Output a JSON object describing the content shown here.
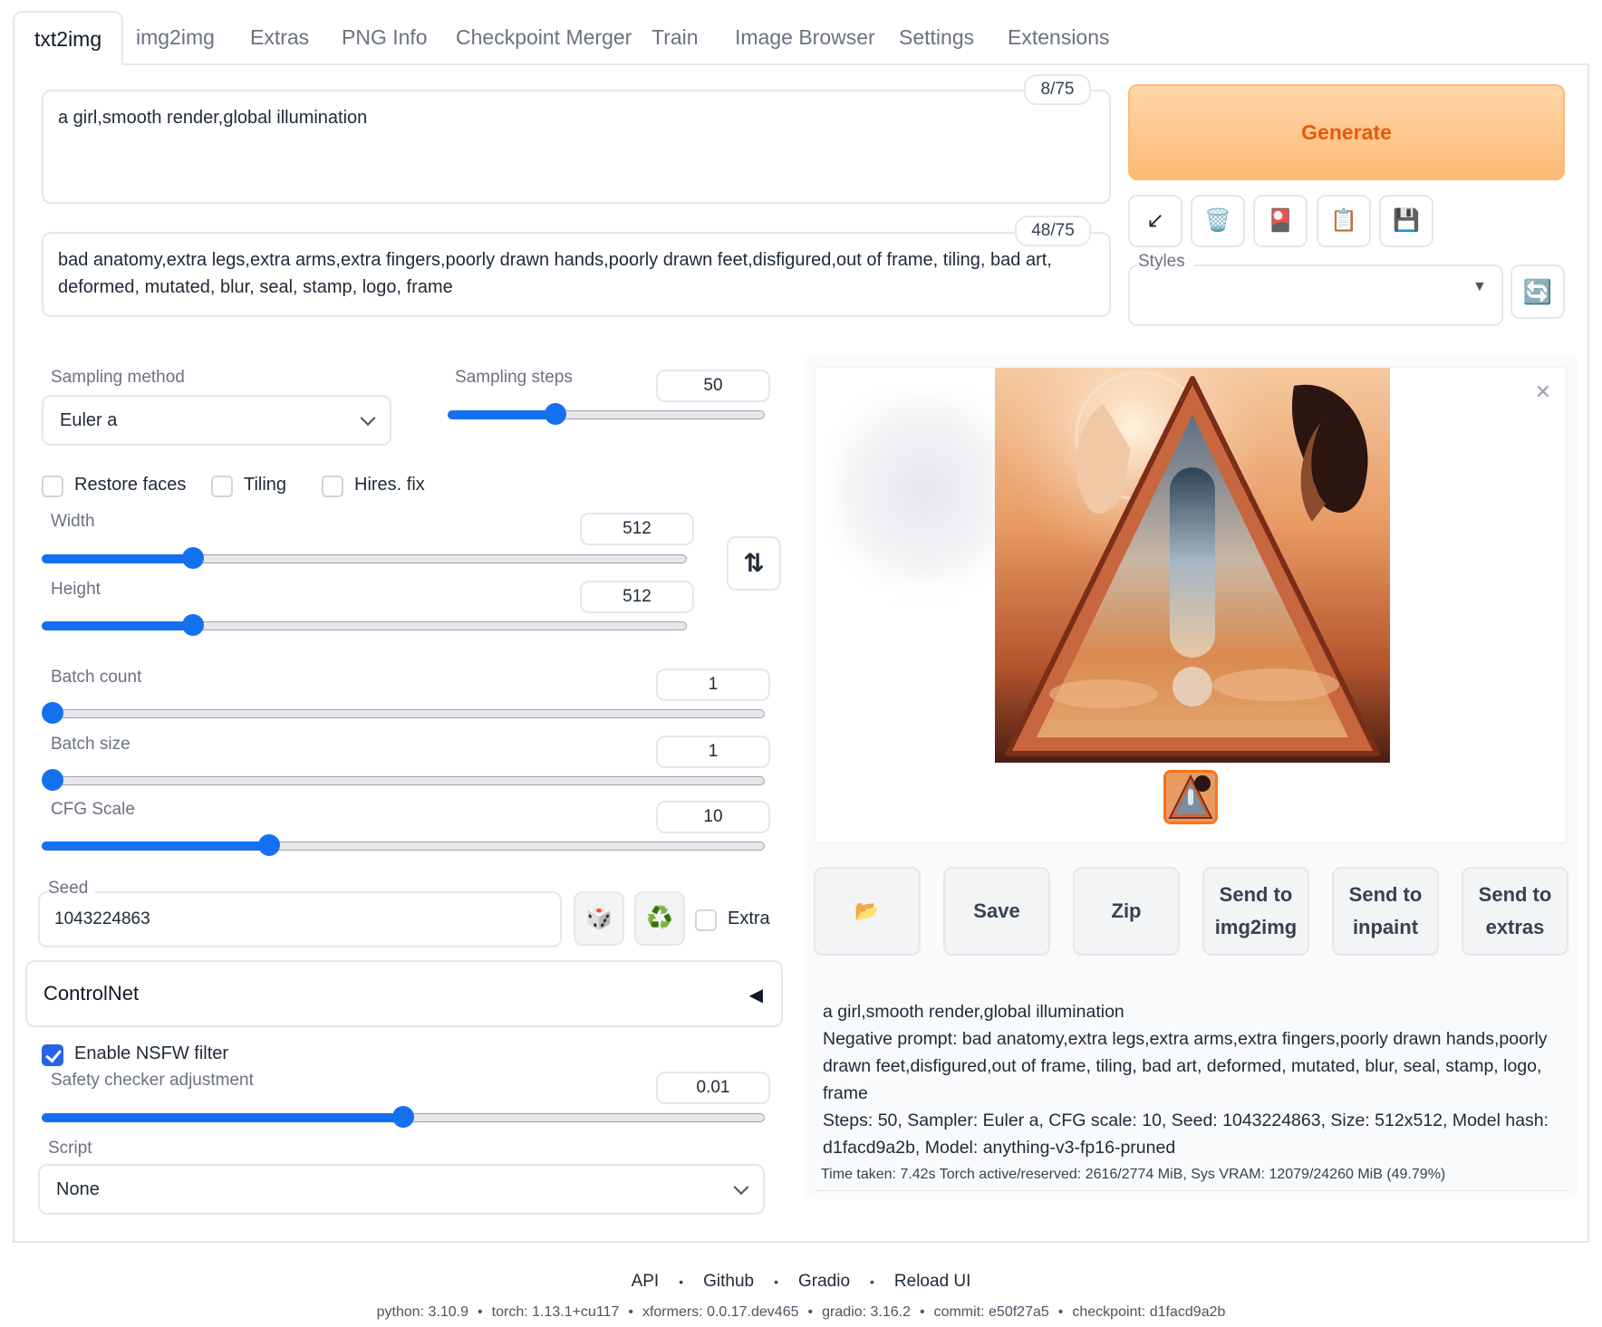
{
  "tabs": [
    "txt2img",
    "img2img",
    "Extras",
    "PNG Info",
    "Checkpoint Merger",
    "Train",
    "Image Browser",
    "Settings",
    "Extensions"
  ],
  "prompt": {
    "text": "a girl,smooth render,global illumination",
    "counter": "8/75"
  },
  "negative_prompt": {
    "text": "bad anatomy,extra legs,extra arms,extra fingers,poorly drawn hands,poorly drawn feet,disfigured,out of frame, tiling, bad art, deformed, mutated, blur, seal, stamp, logo, frame",
    "counter": "48/75"
  },
  "generate_label": "Generate",
  "tool_icons": [
    "↙",
    "🗑️",
    "🎴",
    "📋",
    "💾"
  ],
  "styles": {
    "label": "Styles",
    "value": "",
    "refresh_icon": "🔄"
  },
  "sampling_method": {
    "label": "Sampling method",
    "value": "Euler a"
  },
  "sampling_steps": {
    "label": "Sampling steps",
    "value": "50",
    "fraction": 0.34
  },
  "restore_faces": {
    "label": "Restore faces",
    "checked": false
  },
  "tiling": {
    "label": "Tiling",
    "checked": false
  },
  "hires_fix": {
    "label": "Hires. fix",
    "checked": false
  },
  "width": {
    "label": "Width",
    "value": "512",
    "fraction": 0.235
  },
  "height": {
    "label": "Height",
    "value": "512",
    "fraction": 0.235
  },
  "swap_icon": "⇅",
  "batch_count": {
    "label": "Batch count",
    "value": "1",
    "fraction": 0.0
  },
  "batch_size": {
    "label": "Batch size",
    "value": "1",
    "fraction": 0.0
  },
  "cfg_scale": {
    "label": "CFG Scale",
    "value": "10",
    "fraction": 0.315
  },
  "seed": {
    "label": "Seed",
    "value": "1043224863",
    "dice_icon": "🎲",
    "recycle_icon": "♻️",
    "extra_label": "Extra"
  },
  "controlnet": {
    "title": "ControlNet",
    "toggle_icon": "◀"
  },
  "nsfw": {
    "label": "Enable NSFW filter",
    "checked": true
  },
  "safety": {
    "label": "Safety checker adjustment",
    "value": "0.01",
    "fraction": 0.5
  },
  "script": {
    "label": "Script",
    "value": "None"
  },
  "gallery": {
    "close_icon": "✕"
  },
  "actions": {
    "folder_icon": "📂",
    "save": "Save",
    "zip": "Zip",
    "img2img": "Send to img2img",
    "inpaint": "Send to inpaint",
    "extras": "Send to extras"
  },
  "info": {
    "prompt": "a girl,smooth render,global illumination",
    "negative": "Negative prompt: bad anatomy,extra legs,extra arms,extra fingers,poorly drawn hands,poorly drawn feet,disfigured,out of frame, tiling, bad art, deformed, mutated, blur, seal, stamp, logo, frame",
    "params": "Steps: 50, Sampler: Euler a, CFG scale: 10, Seed: 1043224863, Size: 512x512, Model hash: d1facd9a2b, Model: anything-v3-fp16-pruned",
    "timing": "Time taken: 7.42s  Torch active/reserved: 2616/2774 MiB, Sys VRAM: 12079/24260 MiB (49.79%)"
  },
  "footer": {
    "links": [
      "API",
      "Github",
      "Gradio",
      "Reload UI"
    ],
    "versions": [
      "python: 3.10.9",
      "torch: 1.13.1+cu117",
      "xformers: 0.0.17.dev465",
      "gradio: 3.16.2",
      "commit: e50f27a5",
      "checkpoint: d1facd9a2b"
    ]
  },
  "colors": {
    "accent": "#1570ef",
    "generate_text": "#ea580c",
    "generate_bg": "#fdba74"
  }
}
